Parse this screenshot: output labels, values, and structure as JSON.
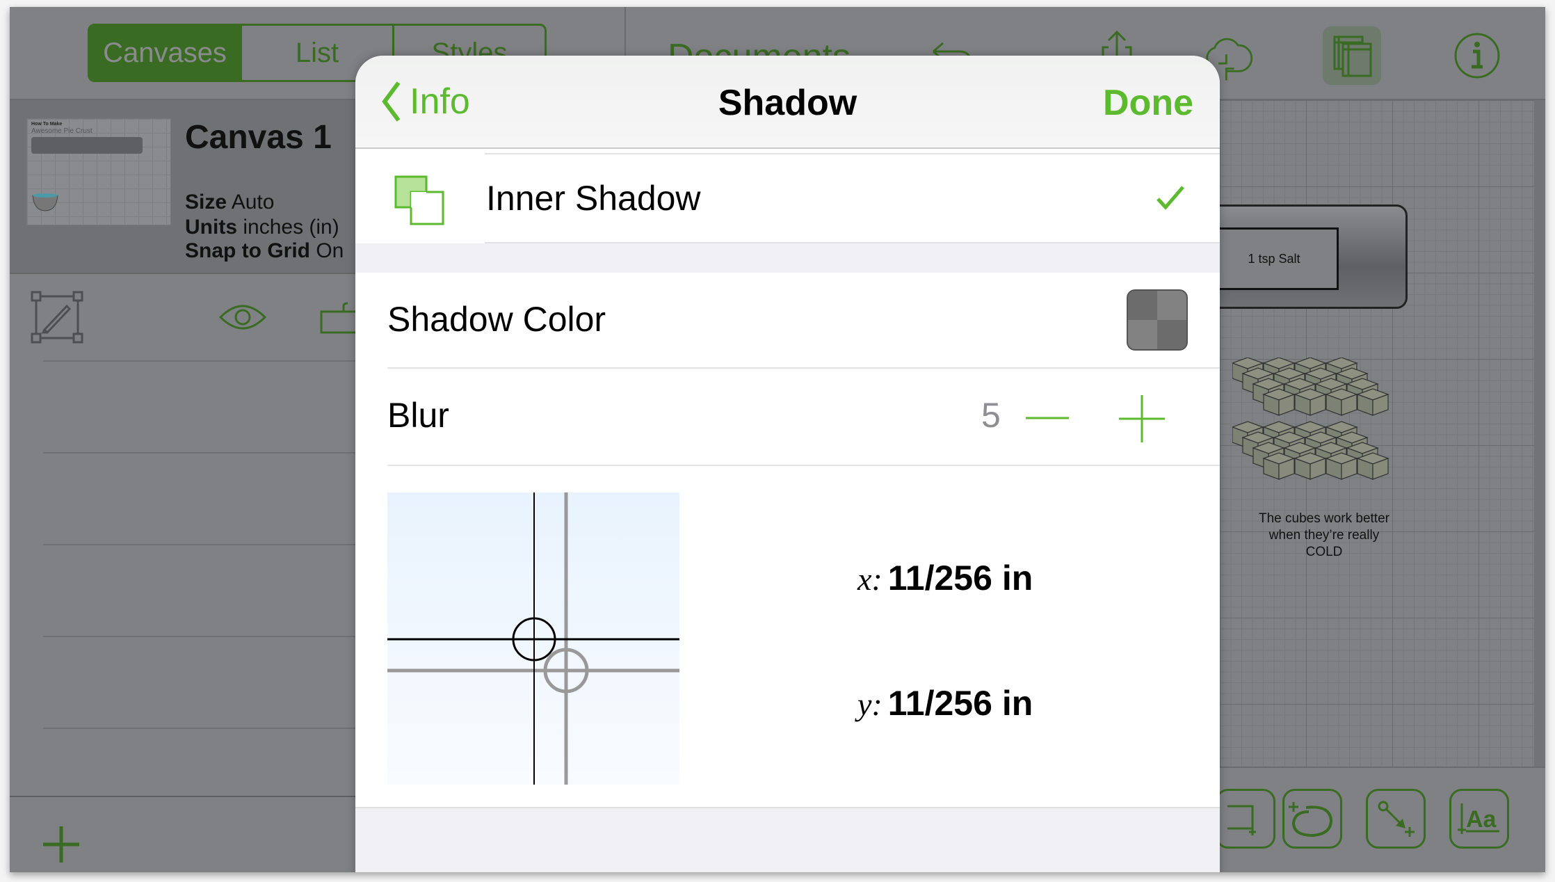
{
  "toolbar": {
    "segments": [
      "Canvases",
      "List",
      "Styles"
    ],
    "active_segment": "Canvases",
    "document_title": "Documents",
    "icons": [
      "undo-icon",
      "share-icon",
      "cloud-sync-icon",
      "canvases-icon",
      "info-icon"
    ]
  },
  "sidebar": {
    "canvas": {
      "name": "Canvas 1",
      "thumbnail_title": "How To Make",
      "thumbnail_subtitle": "Awesome Pie Crust",
      "props": [
        {
          "label": "Size",
          "value": "Auto"
        },
        {
          "label": "Units",
          "value": "inches (in)"
        },
        {
          "label": "Snap to Grid",
          "value": "On"
        }
      ]
    },
    "add_label": "+"
  },
  "canvas": {
    "salt_label": "1 tsp Salt",
    "caption_lines": [
      "The cubes work better",
      "when they’re really",
      "COLD"
    ]
  },
  "popover": {
    "back_label": "Info",
    "title": "Shadow",
    "done_label": "Done",
    "shadow_type": {
      "label": "Inner Shadow",
      "selected": true
    },
    "shadow_color": {
      "label": "Shadow Color",
      "color": "#737373"
    },
    "blur": {
      "label": "Blur",
      "value": "5"
    },
    "offset": {
      "x_label": "x:",
      "x_value": "11/256 in",
      "y_label": "y:",
      "y_value": "11/256 in"
    }
  },
  "colors": {
    "accent": "#5cba2e",
    "dimmed_accent": "#3a6b22"
  }
}
